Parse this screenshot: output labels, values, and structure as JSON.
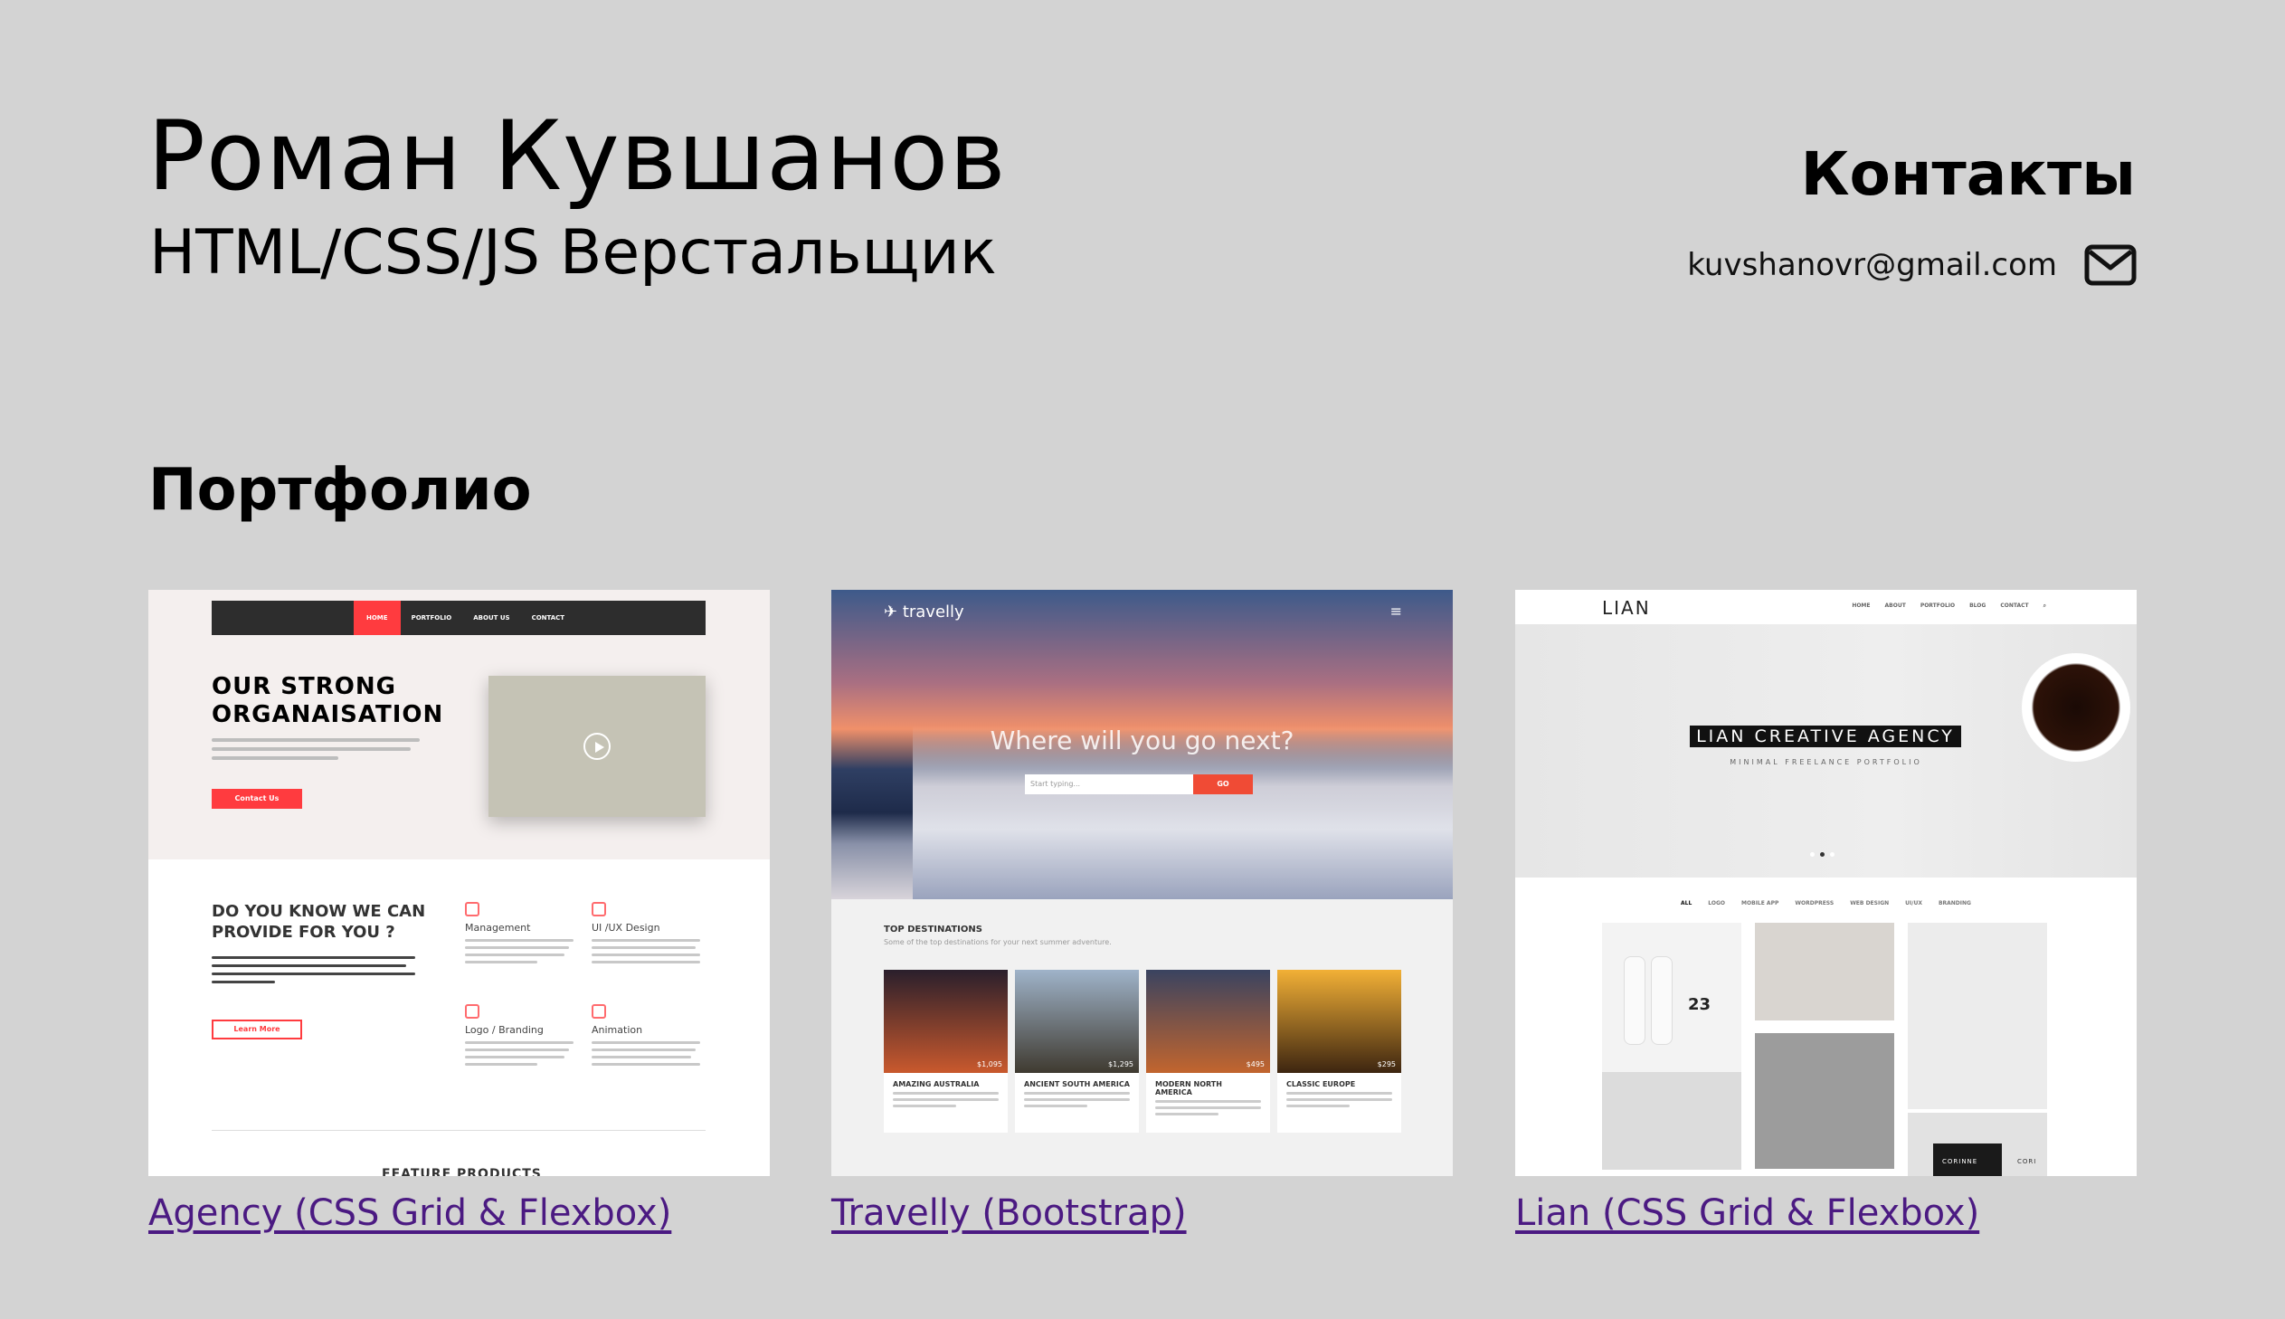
{
  "header": {
    "name": "Роман Кувшанов",
    "role": "HTML/CSS/JS Верстальщик"
  },
  "contacts": {
    "title": "Контакты",
    "email": "kuvshanovr@gmail.com",
    "email_icon": "mail-icon"
  },
  "portfolio": {
    "title": "Портфолио",
    "items": [
      {
        "label": "Agency (CSS Grid & Flexbox)",
        "preview": {
          "nav": [
            "HOME",
            "PORTFOLIO",
            "ABOUT US",
            "CONTACT"
          ],
          "headline_1": "OUR STRONG",
          "headline_2": "ORGANAISATION",
          "cta": "Contact Us",
          "question_1": "DO YOU KNOW WE CAN",
          "question_2": "PROVIDE FOR YOU ?",
          "cta_2": "Learn More",
          "features": [
            "Management",
            "UI /UX Design",
            "Logo / Branding",
            "Animation"
          ],
          "footer_heading": "FEATURE PRODUCTS"
        }
      },
      {
        "label": "Travelly (Bootstrap)",
        "preview": {
          "logo": "travelly",
          "menu_icon": "≡",
          "headline": "Where will you go next?",
          "search_placeholder": "Start typing...",
          "search_button": "GO",
          "section_title": "TOP DESTINATIONS",
          "section_subtitle": "Some of the top destinations for your next summer adventure.",
          "destinations": [
            {
              "name": "AMAZING AUSTRALIA",
              "price": "$1,095",
              "color_top": "#2a1f2c",
              "color_bottom": "#c9592d"
            },
            {
              "name": "ANCIENT SOUTH AMERICA",
              "price": "$1,295",
              "color_top": "#9fb3c9",
              "color_bottom": "#3f3a30"
            },
            {
              "name": "MODERN NORTH AMERICA",
              "price": "$495",
              "color_top": "#3a4360",
              "color_bottom": "#c2652e"
            },
            {
              "name": "CLASSIC EUROPE",
              "price": "$295",
              "color_top": "#f2b036",
              "color_bottom": "#3d2510"
            }
          ]
        }
      },
      {
        "label": "Lian (CSS Grid & Flexbox)",
        "preview": {
          "logo": "LIAN",
          "nav": [
            "HOME",
            "ABOUT",
            "PORTFOLIO",
            "BLOG",
            "CONTACT"
          ],
          "banner": "LIAN CREATIVE AGENCY",
          "tagline": "MINIMAL FREELANCE PORTFOLIO",
          "filters": [
            "ALL",
            "LOGO",
            "MOBILE APP",
            "WORDPRESS",
            "WEB DESIGN",
            "UI/UX",
            "BRANDING"
          ],
          "product_number": "23",
          "card_label": "CORINNE",
          "card_label_2": "CORI"
        }
      }
    ]
  },
  "colors": {
    "background": "#d3d3d3",
    "link": "#4b1a82",
    "accent_red": "#ff3b3f",
    "travelly_orange": "#f04b35"
  }
}
